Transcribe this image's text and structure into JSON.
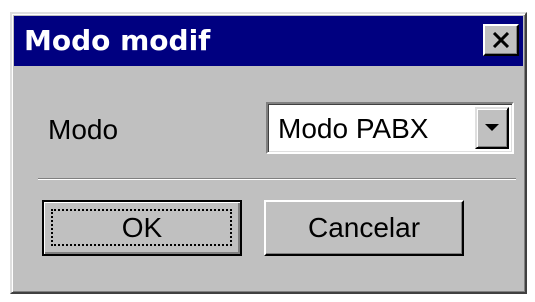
{
  "window": {
    "title": "Modo modif",
    "close_icon": "close-icon"
  },
  "form": {
    "mode_label": "Modo",
    "mode_select": {
      "selected": "Modo PABX",
      "arrow_icon": "chevron-down-icon"
    }
  },
  "buttons": {
    "ok_label": "OK",
    "cancel_label": "Cancelar"
  },
  "colors": {
    "titlebar": "#000080",
    "face": "#c0c0c0"
  }
}
